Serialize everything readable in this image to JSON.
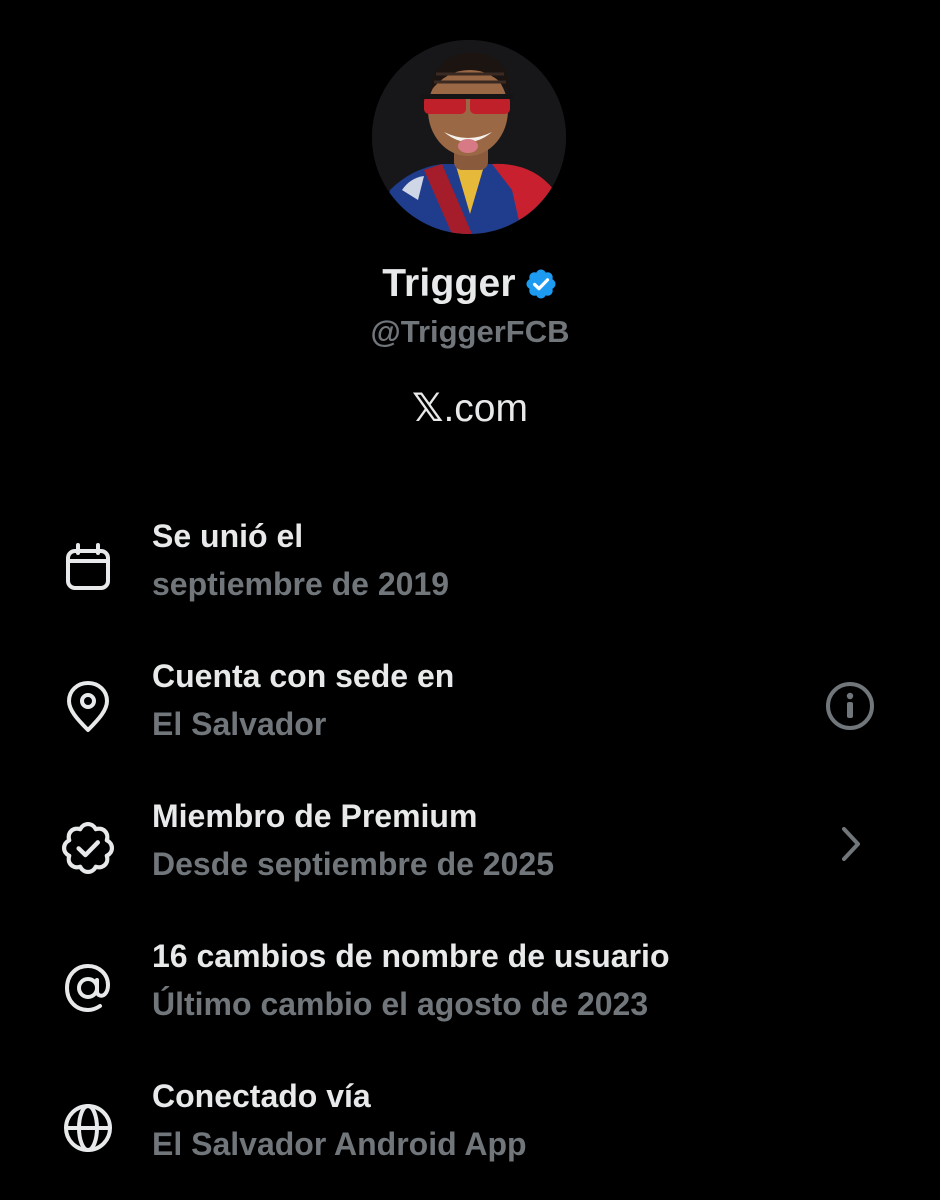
{
  "profile": {
    "display_name": "Trigger",
    "handle": "@TriggerFCB",
    "verified_color": "#1d9bf0",
    "site_prefix": "𝕏",
    "site_suffix": ".com"
  },
  "about": [
    {
      "icon": "calendar-icon",
      "title": "Se unió el",
      "subtitle": "septiembre de 2019",
      "trailing": ""
    },
    {
      "icon": "location-pin-icon",
      "title": "Cuenta con sede en",
      "subtitle": "El Salvador",
      "trailing": "info-icon"
    },
    {
      "icon": "verified-badge-icon",
      "title": "Miembro de Premium",
      "subtitle": "Desde septiembre de 2025",
      "trailing": "chevron-right-icon"
    },
    {
      "icon": "at-sign-icon",
      "title": "16 cambios de nombre de usuario",
      "subtitle": "Último cambio el agosto de 2023",
      "trailing": ""
    },
    {
      "icon": "globe-icon",
      "title": "Conectado vía",
      "subtitle": "El Salvador Android App",
      "trailing": ""
    }
  ],
  "colors": {
    "background": "#000000",
    "primary_text": "#e7e9ea",
    "secondary_text": "#71767b"
  }
}
